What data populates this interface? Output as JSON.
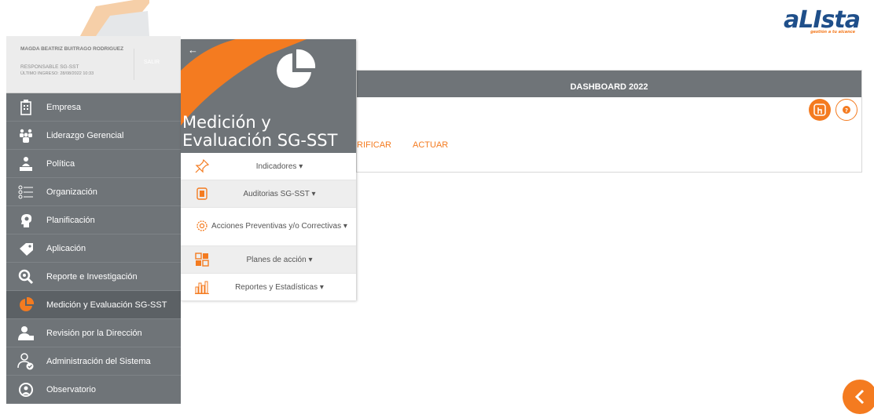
{
  "brand": {
    "logo_text": "aLIsta",
    "tagline": "gestión a tu alcance"
  },
  "user": {
    "name": "MAGDA BEATRIZ BUITRAGO RODRIGUEZ",
    "role": "RESPONSABLE SG-SST",
    "last_login": "ÚLTIMO INGRESO: 28/08/2022 10:33",
    "logout_label": "SALIR"
  },
  "sidebar": {
    "items": [
      {
        "label": "Empresa",
        "icon": "building-icon"
      },
      {
        "label": "Liderazgo Gerencial",
        "icon": "team-icon"
      },
      {
        "label": "Política",
        "icon": "person-podium-icon"
      },
      {
        "label": "Organización",
        "icon": "list-icon"
      },
      {
        "label": "Planificación",
        "icon": "head-bulb-icon"
      },
      {
        "label": "Aplicación",
        "icon": "tag-icon"
      },
      {
        "label": "Reporte e Investigación",
        "icon": "search-icon"
      },
      {
        "label": "Medición y Evaluación SG-SST",
        "icon": "pie-chart-icon"
      },
      {
        "label": "Revisión por la Dirección",
        "icon": "manager-icon"
      },
      {
        "label": "Administración del Sistema",
        "icon": "admin-user-icon"
      },
      {
        "label": "Observatorio",
        "icon": "observatory-icon"
      }
    ]
  },
  "flyout": {
    "title": "Medición y Evaluación SG-SST",
    "items": [
      {
        "label": "Indicadores",
        "icon": "pushpin-icon"
      },
      {
        "label": "Auditorias SG-SST",
        "icon": "audit-icon"
      },
      {
        "label": "Acciones Preventivas y/o Correctivas",
        "icon": "gears-icon"
      },
      {
        "label": "Planes de acción",
        "icon": "grid-icon"
      },
      {
        "label": "Reportes y Estadísticas",
        "icon": "bar-chart-icon"
      }
    ]
  },
  "dashboard": {
    "title": "DASHBOARD 2022",
    "tabs": [
      "RIFICAR",
      "ACTUAR"
    ]
  },
  "colors": {
    "accent": "#f47b20",
    "sidebar": "#6f7478",
    "active": "#5c6165"
  }
}
